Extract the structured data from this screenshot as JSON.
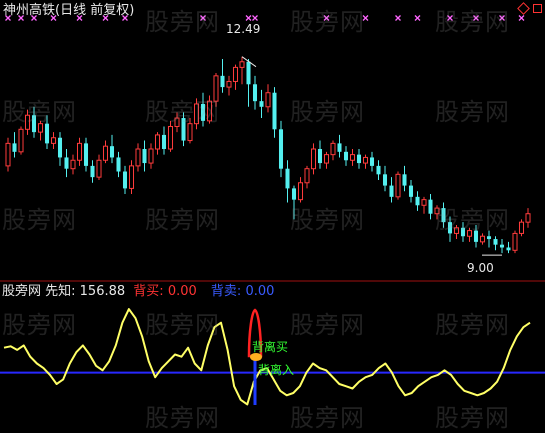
{
  "watermark": "股旁网",
  "price_panel": {
    "title": "神州高铁(日线 前复权)",
    "high_label": "12.49",
    "low_label": "9.00",
    "ylim": [
      8.7,
      13.0
    ]
  },
  "indicator_panel": {
    "prefix": "股旁网 先知:",
    "value": "156.88",
    "buy_label": "背买:",
    "buy_value": "0.00",
    "sell_label": "背卖:",
    "sell_value": "0.00",
    "annot_sell": "背离买",
    "annot_buy": "背离入"
  },
  "colors": {
    "background": "#000000",
    "up": "#ff3c3c",
    "down": "#54f0f0",
    "line": "#ffff66",
    "baseline": "#2828ff",
    "marker": "#ff66ff",
    "divider": "#a01010",
    "title": "#e8e8e8",
    "buy": "#ff3333",
    "sell": "#3a5bff",
    "annot": "#33ff33"
  },
  "chart_data": [
    {
      "type": "candlestick",
      "title": "神州高铁(日线 前复权)",
      "ylim": [
        8.7,
        13.0
      ],
      "candles": [
        [
          10.55,
          11.05,
          10.95,
          10.45
        ],
        [
          10.95,
          11.15,
          10.8,
          10.7
        ],
        [
          10.8,
          11.25,
          11.2,
          10.75
        ],
        [
          11.2,
          11.55,
          11.45,
          11.1
        ],
        [
          11.45,
          11.6,
          11.15,
          11.05
        ],
        [
          11.15,
          11.35,
          11.3,
          11.0
        ],
        [
          11.3,
          11.45,
          10.95,
          10.85
        ],
        [
          10.95,
          11.15,
          11.05,
          10.85
        ],
        [
          11.05,
          11.15,
          10.7,
          10.55
        ],
        [
          10.7,
          10.85,
          10.5,
          10.35
        ],
        [
          10.5,
          10.75,
          10.65,
          10.4
        ],
        [
          10.65,
          11.05,
          10.95,
          10.55
        ],
        [
          10.95,
          11.05,
          10.55,
          10.45
        ],
        [
          10.55,
          10.65,
          10.35,
          10.25
        ],
        [
          10.35,
          10.75,
          10.65,
          10.3
        ],
        [
          10.65,
          11.0,
          10.9,
          10.6
        ],
        [
          10.9,
          11.1,
          10.7,
          10.6
        ],
        [
          10.7,
          10.8,
          10.45,
          10.35
        ],
        [
          10.45,
          10.55,
          10.15,
          10.05
        ],
        [
          10.15,
          10.65,
          10.55,
          10.05
        ],
        [
          10.55,
          10.95,
          10.85,
          10.45
        ],
        [
          10.85,
          11.0,
          10.6,
          10.45
        ],
        [
          10.6,
          10.95,
          10.85,
          10.5
        ],
        [
          10.85,
          11.15,
          11.1,
          10.75
        ],
        [
          11.1,
          11.25,
          10.85,
          10.75
        ],
        [
          10.85,
          11.35,
          11.25,
          10.8
        ],
        [
          11.25,
          11.5,
          11.4,
          11.15
        ],
        [
          11.4,
          11.5,
          11.0,
          10.9
        ],
        [
          11.0,
          11.4,
          11.3,
          10.95
        ],
        [
          11.3,
          11.75,
          11.65,
          11.2
        ],
        [
          11.65,
          11.85,
          11.35,
          11.25
        ],
        [
          11.35,
          11.8,
          11.7,
          11.3
        ],
        [
          11.7,
          12.2,
          12.15,
          11.6
        ],
        [
          12.15,
          12.45,
          11.95,
          11.85
        ],
        [
          11.95,
          12.15,
          12.05,
          11.8
        ],
        [
          12.05,
          12.35,
          12.3,
          11.9
        ],
        [
          12.3,
          12.49,
          12.4,
          12.0
        ],
        [
          12.4,
          12.45,
          12.0,
          11.6
        ],
        [
          12.0,
          12.15,
          11.7,
          11.55
        ],
        [
          11.7,
          11.9,
          11.6,
          11.4
        ],
        [
          11.6,
          12.0,
          11.85,
          11.5
        ],
        [
          11.85,
          11.95,
          11.2,
          11.05
        ],
        [
          11.2,
          11.35,
          10.5,
          10.35
        ],
        [
          10.5,
          10.65,
          10.15,
          9.9
        ],
        [
          10.15,
          10.2,
          9.95,
          9.6
        ],
        [
          9.95,
          10.35,
          10.25,
          9.9
        ],
        [
          10.25,
          10.55,
          10.5,
          10.15
        ],
        [
          10.5,
          10.95,
          10.85,
          10.4
        ],
        [
          10.85,
          11.0,
          10.6,
          10.5
        ],
        [
          10.6,
          10.8,
          10.75,
          10.5
        ],
        [
          10.75,
          11.0,
          10.95,
          10.65
        ],
        [
          10.95,
          11.1,
          10.8,
          10.7
        ],
        [
          10.8,
          10.9,
          10.65,
          10.55
        ],
        [
          10.65,
          10.85,
          10.75,
          10.55
        ],
        [
          10.75,
          10.85,
          10.6,
          10.5
        ],
        [
          10.6,
          10.75,
          10.7,
          10.5
        ],
        [
          10.7,
          10.8,
          10.55,
          10.45
        ],
        [
          10.55,
          10.65,
          10.4,
          10.3
        ],
        [
          10.4,
          10.55,
          10.2,
          10.1
        ],
        [
          10.2,
          10.35,
          10.0,
          9.9
        ],
        [
          10.0,
          10.45,
          10.4,
          9.95
        ],
        [
          10.4,
          10.55,
          10.2,
          10.1
        ],
        [
          10.2,
          10.3,
          10.0,
          9.9
        ],
        [
          10.0,
          10.1,
          9.85,
          9.75
        ],
        [
          9.85,
          10.0,
          9.95,
          9.7
        ],
        [
          9.95,
          10.05,
          9.7,
          9.6
        ],
        [
          9.7,
          9.85,
          9.8,
          9.6
        ],
        [
          9.8,
          9.9,
          9.55,
          9.45
        ],
        [
          9.55,
          9.65,
          9.35,
          9.2
        ],
        [
          9.35,
          9.5,
          9.45,
          9.25
        ],
        [
          9.45,
          9.55,
          9.3,
          9.2
        ],
        [
          9.3,
          9.45,
          9.4,
          9.2
        ],
        [
          9.4,
          9.5,
          9.2,
          9.1
        ],
        [
          9.2,
          9.35,
          9.3,
          9.15
        ],
        [
          9.3,
          9.4,
          9.25,
          9.1
        ],
        [
          9.25,
          9.3,
          9.15,
          9.05
        ],
        [
          9.15,
          9.25,
          9.1,
          9.0
        ],
        [
          9.1,
          9.2,
          9.05,
          9.0
        ],
        [
          9.05,
          9.4,
          9.35,
          9.0
        ],
        [
          9.35,
          9.6,
          9.55,
          9.3
        ],
        [
          9.55,
          9.8,
          9.7,
          9.45
        ]
      ],
      "markers_top_index": [
        0,
        2,
        4,
        7,
        11,
        15,
        18,
        30,
        37,
        38,
        49,
        55,
        60,
        63,
        68,
        72,
        76,
        79
      ]
    },
    {
      "type": "line",
      "title": "先知",
      "baseline": 0,
      "ylim": [
        -100,
        160
      ],
      "values": [
        55,
        58,
        50,
        60,
        35,
        20,
        10,
        -5,
        -25,
        -15,
        20,
        45,
        60,
        40,
        15,
        5,
        25,
        60,
        110,
        140,
        120,
        80,
        25,
        -10,
        10,
        25,
        40,
        35,
        55,
        20,
        5,
        60,
        100,
        110,
        50,
        -30,
        -60,
        -70,
        -20,
        5,
        10,
        -15,
        -40,
        -50,
        -45,
        -30,
        0,
        20,
        10,
        5,
        -10,
        -25,
        -30,
        -35,
        -20,
        -10,
        -5,
        10,
        20,
        0,
        -30,
        -50,
        -45,
        -30,
        -20,
        -10,
        -5,
        5,
        -5,
        -25,
        -40,
        -45,
        -50,
        -45,
        -35,
        -20,
        10,
        50,
        80,
        100,
        110
      ]
    }
  ]
}
